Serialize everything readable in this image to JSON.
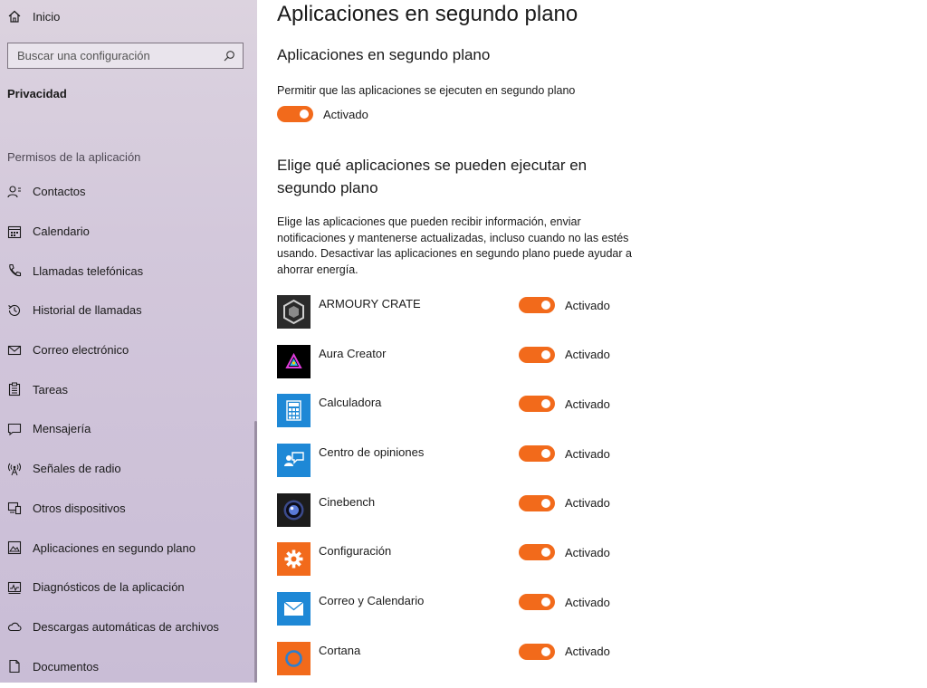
{
  "sidebar": {
    "home_label": "Inicio",
    "search_placeholder": "Buscar una configuración",
    "section_title": "Privacidad",
    "group_title": "Permisos de la aplicación",
    "items": [
      {
        "label": "Contactos",
        "icon": "contacts-icon"
      },
      {
        "label": "Calendario",
        "icon": "calendar-icon"
      },
      {
        "label": "Llamadas telefónicas",
        "icon": "phone-icon"
      },
      {
        "label": "Historial de llamadas",
        "icon": "history-icon"
      },
      {
        "label": "Correo electrónico",
        "icon": "mail-icon"
      },
      {
        "label": "Tareas",
        "icon": "tasks-icon"
      },
      {
        "label": "Mensajería",
        "icon": "messaging-icon"
      },
      {
        "label": "Señales de radio",
        "icon": "radio-icon"
      },
      {
        "label": "Otros dispositivos",
        "icon": "devices-icon"
      },
      {
        "label": "Aplicaciones en segundo plano",
        "icon": "background-apps-icon"
      },
      {
        "label": "Diagnósticos de la aplicación",
        "icon": "diagnostics-icon"
      },
      {
        "label": "Descargas automáticas de archivos",
        "icon": "cloud-icon"
      },
      {
        "label": "Documentos",
        "icon": "document-icon"
      }
    ]
  },
  "main": {
    "page_title": "Aplicaciones en segundo plano",
    "section1_title": "Aplicaciones en segundo plano",
    "allow_text": "Permitir que las aplicaciones se ejecuten en segundo plano",
    "master_toggle_label": "Activado",
    "section2_title": "Elige qué aplicaciones se pueden ejecutar en segundo plano",
    "section2_desc": "Elige las aplicaciones que pueden recibir información, enviar notificaciones y mantenerse actualizadas, incluso cuando no las estés usando. Desactivar las aplicaciones en segundo plano puede ayudar a ahorrar energía.",
    "apps": [
      {
        "name": "ARMOURY CRATE",
        "state": "Activado",
        "icon": "armoury-crate-icon"
      },
      {
        "name": "Aura Creator",
        "state": "Activado",
        "icon": "aura-creator-icon"
      },
      {
        "name": "Calculadora",
        "state": "Activado",
        "icon": "calculator-icon"
      },
      {
        "name": "Centro de opiniones",
        "state": "Activado",
        "icon": "feedback-hub-icon"
      },
      {
        "name": "Cinebench",
        "state": "Activado",
        "icon": "cinebench-icon"
      },
      {
        "name": "Configuración",
        "state": "Activado",
        "icon": "settings-icon"
      },
      {
        "name": "Correo y Calendario",
        "state": "Activado",
        "icon": "mail-calendar-icon"
      },
      {
        "name": "Cortana",
        "state": "Activado",
        "icon": "cortana-icon"
      }
    ]
  },
  "colors": {
    "accent": "#f26a1b",
    "sidebar_bg": "#d3c8db",
    "app_blue": "#1e88d6",
    "app_orange": "#f26a1b"
  }
}
